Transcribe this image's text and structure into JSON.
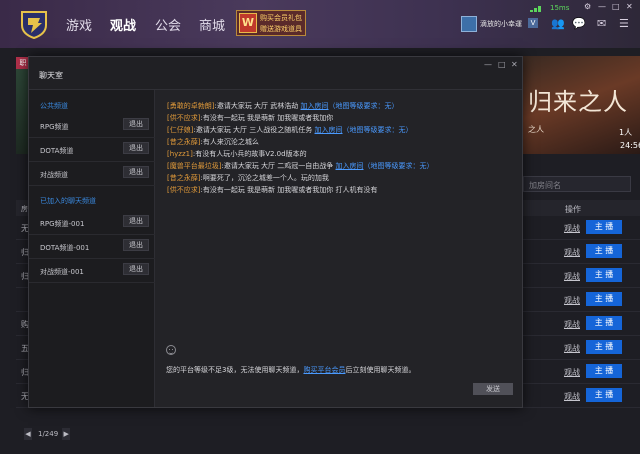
{
  "topbar": {
    "nav": [
      "游戏",
      "观战",
      "公会",
      "商城"
    ],
    "promo": {
      "badge": "W",
      "line1": "购买会员礼包",
      "line2": "赠送游戏道具"
    },
    "user": {
      "name": "滴放的小幸運",
      "level": "V"
    },
    "ping": "15ms",
    "colors": {
      "accent": "#4a3a5c"
    }
  },
  "background": {
    "hero_left_badge": "职",
    "hero_right": {
      "title": "归来之人",
      "subtitle": "之人",
      "count": "1人",
      "time": "24:56"
    },
    "search_placeholder": "加房间名",
    "table": {
      "col_room": "房",
      "col_op": "操作"
    },
    "rows": [
      {
        "name": "无",
        "watch": "观战",
        "host": "主 播"
      },
      {
        "name": "归",
        "watch": "观战",
        "host": "主 播"
      },
      {
        "name": "归",
        "watch": "观战",
        "host": "主 播"
      },
      {
        "name": "",
        "watch": "观战",
        "host": "主 播"
      },
      {
        "name": "购",
        "watch": "观战",
        "host": "主 播"
      },
      {
        "name": "五",
        "watch": "观战",
        "host": "主 播"
      },
      {
        "name": "归",
        "watch": "观战",
        "host": "主 播"
      },
      {
        "name": "无",
        "watch": "观战",
        "host": "主 播"
      }
    ],
    "pager": {
      "prev": "◀",
      "text": "1/249",
      "next": "▶"
    }
  },
  "modal": {
    "title": "聊天室",
    "controls": {
      "min": "—",
      "max": "□",
      "close": "✕"
    },
    "sidebar": {
      "section_public": "公共频道",
      "public_channels": [
        "RPG频道",
        "DOTA频道",
        "对战频道"
      ],
      "section_joined": "已加入的聊天频道",
      "joined_channels": [
        "RPG频道-001",
        "DOTA频道-001",
        "对战频道-001"
      ],
      "exit_label": "退出"
    },
    "messages": [
      {
        "name": "[勇敢的卓勃朗]",
        "text": ":邀请大家玩 大厅 武林浩劫 ",
        "link": "加入房间",
        "req": "（地图等级要求：无）"
      },
      {
        "name": "[供不应求]",
        "text": ":有没有一起玩 我是萌新 加我喔或者我加你",
        "link": "",
        "req": ""
      },
      {
        "name": "[仁仔娘]",
        "text": ":邀请大家玩 大厅 三人战役之随机任务 ",
        "link": "加入房间",
        "req": "（地图等级要求：无）"
      },
      {
        "name": "[昔之永薛]",
        "text": ":有人来沉沦之城么",
        "link": "",
        "req": ""
      },
      {
        "name": "[hyzz1]",
        "text": ":有没有人玩小兵的故事V2.0d版本的",
        "link": "",
        "req": ""
      },
      {
        "name": "[魔兽平台最垃圾]",
        "text": ":邀请大家玩 大厅 二鸡冠一自由战争 ",
        "link": "加入房间",
        "req": "（地图等级要求：无）"
      },
      {
        "name": "[昔之永薛]",
        "text": ":啊要死了，沉沦之城差一个人。玩的加我",
        "link": "",
        "req": ""
      },
      {
        "name": "[供不应求]",
        "text": ":有没有一起玩 我是萌新 加我喔或者我加你 打人机有没有",
        "link": "",
        "req": ""
      }
    ],
    "notice": {
      "before": "您的平台等级不足3级，无法使用聊天频道，",
      "link": "购买平台会员",
      "after": "后立刻使用聊天频道。"
    },
    "send_label": "发送"
  }
}
